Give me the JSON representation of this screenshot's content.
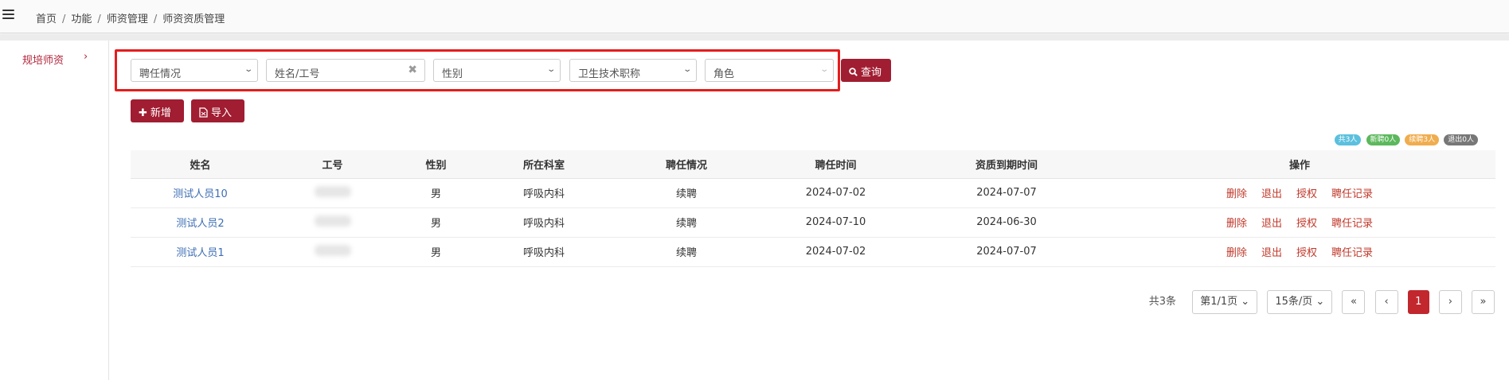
{
  "breadcrumb": [
    "首页",
    "功能",
    "师资管理",
    "师资资质管理"
  ],
  "sidebar": {
    "items": [
      {
        "label": "规培师资",
        "chevron": "›"
      }
    ]
  },
  "filters": {
    "employment": "聘任情况",
    "name_placeholder": "姓名/工号",
    "gender": "性别",
    "title": "卫生技术职称",
    "role": "角色",
    "query_label": "查询",
    "clear_glyph": "✖"
  },
  "actions": {
    "add_label": "新增",
    "import_label": "导入"
  },
  "badges": [
    {
      "text": "共3人",
      "color": "#5bc0de"
    },
    {
      "text": "新聘0人",
      "color": "#5cb85c"
    },
    {
      "text": "续聘3人",
      "color": "#f0ad4e"
    },
    {
      "text": "退出0人",
      "color": "#777777"
    }
  ],
  "table": {
    "columns": [
      "姓名",
      "工号",
      "性别",
      "所在科室",
      "聘任情况",
      "聘任时间",
      "资质到期时间",
      "操作"
    ],
    "rows": [
      {
        "name": "测试人员10",
        "gender": "男",
        "dept": "呼吸内科",
        "status": "续聘",
        "appointed": "2024-07-02",
        "expires": "2024-07-07"
      },
      {
        "name": "测试人员2",
        "gender": "男",
        "dept": "呼吸内科",
        "status": "续聘",
        "appointed": "2024-07-10",
        "expires": "2024-06-30"
      },
      {
        "name": "测试人员1",
        "gender": "男",
        "dept": "呼吸内科",
        "status": "续聘",
        "appointed": "2024-07-02",
        "expires": "2024-07-07"
      }
    ],
    "row_actions": [
      "删除",
      "退出",
      "授权",
      "聘任记录"
    ]
  },
  "pager": {
    "total": "共3条",
    "page": "第1/1页",
    "page_size": "15条/页",
    "first": "«",
    "prev": "‹",
    "current": "1",
    "next": "›",
    "last": "»"
  },
  "colors": {
    "brand": "#a11d31",
    "link": "#3c6eb4",
    "highlight_box": "#e41d1d"
  }
}
